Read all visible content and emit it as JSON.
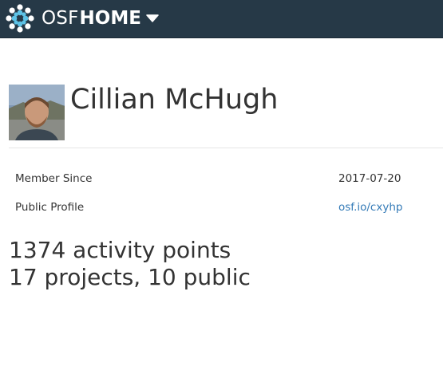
{
  "navbar": {
    "brand_osf": "OSF",
    "brand_home": "HOME",
    "logo_icon": "osf-logo-icon",
    "caret_icon": "caret-down-icon",
    "background": "#263947"
  },
  "profile": {
    "name": "Cillian McHugh",
    "avatar_icon": "user-avatar-photo"
  },
  "info": {
    "member_since_label": "Member Since",
    "member_since_value": "2017-07-20",
    "public_profile_label": "Public Profile",
    "public_profile_value": "osf.io/cxyhp",
    "link_color": "#337ab7"
  },
  "stats": {
    "activity": "1374 activity points",
    "projects": "17 projects, 10 public"
  }
}
